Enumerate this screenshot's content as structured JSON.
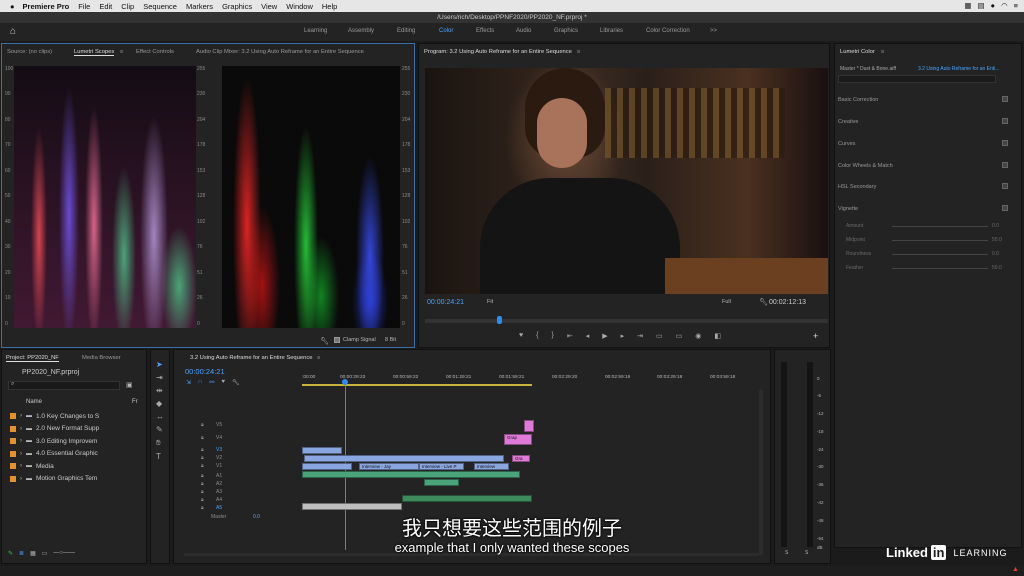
{
  "menubar": {
    "apple": "",
    "app": "Premiere Pro",
    "items": [
      "File",
      "Edit",
      "Clip",
      "Sequence",
      "Markers",
      "Graphics",
      "View",
      "Window",
      "Help"
    ]
  },
  "titlebar": "/Users/rich/Desktop/PPNF2020/PP2020_NF.prproj *",
  "workspaces": [
    "Learning",
    "Assembly",
    "Editing",
    "Color",
    "Effects",
    "Audio",
    "Graphics",
    "Libraries",
    "Color Correction"
  ],
  "workspace_more": ">>",
  "scopes": {
    "tabs": [
      "Source: (no clips)",
      "Lumetri Scopes",
      "Effect Controls",
      "Audio Clip Mixer: 3.2 Using Auto Reframe for an Entire Sequence"
    ],
    "left_axis": [
      "100",
      "90",
      "80",
      "70",
      "60",
      "50",
      "40",
      "30",
      "20",
      "10",
      "0"
    ],
    "right_axis": [
      "255",
      "230",
      "204",
      "178",
      "153",
      "128",
      "102",
      "76",
      "51",
      "26",
      "0"
    ],
    "clamp": "Clamp Signal",
    "bits": "8 Bit"
  },
  "program": {
    "title": "Program: 3.2 Using Auto Reframe for an Entire Sequence",
    "timecode": "00:00:24:21",
    "fit": "Fit",
    "full": "Full",
    "duration": "00:02:12:13"
  },
  "lumetri": {
    "title": "Lumetri Color",
    "master": "Master * Dust & Bone.aiff",
    "seq": "3.2 Using Auto Reframe for an Enti...",
    "sections": [
      "Basic Correction",
      "Creative",
      "Curves",
      "Color Wheels & Match",
      "HSL Secondary",
      "Vignette"
    ],
    "vignette": [
      {
        "label": "Amount",
        "val": "0.0"
      },
      {
        "label": "Midpoint",
        "val": "50.0"
      },
      {
        "label": "Roundness",
        "val": "0.0"
      },
      {
        "label": "Feather",
        "val": "50.0"
      }
    ]
  },
  "project": {
    "tabs": [
      "Project: PP2020_NF",
      "Media Browser"
    ],
    "file": "PP2020_NF.prproj",
    "col_name": "Name",
    "col_fr": "Fr",
    "bins": [
      "1.0 Key Changes to S",
      "2.0 New Format Supp",
      "3.0 Editing Improvem",
      "4.0 Essential Graphic",
      "Media",
      "Motion Graphics Tem"
    ]
  },
  "timeline": {
    "title": "3.2 Using Auto Reframe for an Entire Sequence",
    "timecode": "00:00:24:21",
    "ruler": [
      ":00:00",
      "00:00:29:23",
      "00:00:59:22",
      "00:01:29:21",
      "00:01:59:21",
      "00:02:29:20",
      "00:02:59:19",
      "00:03:29:18",
      "00:03:59:18"
    ],
    "video_tracks": [
      "V5",
      "V4",
      "V3",
      "V2",
      "V1"
    ],
    "audio_tracks": [
      "A1",
      "A2",
      "A3",
      "A4",
      "A5"
    ],
    "master": "Master",
    "master_val": "0.0",
    "clips": [
      "Grap",
      "Interview - Jay",
      "Interview - Live P",
      "Interview",
      "Gra"
    ]
  },
  "meter": {
    "scale": [
      "0",
      "-6",
      "-12",
      "-18",
      "-24",
      "-30",
      "-36",
      "-42",
      "-48",
      "-54",
      "dB"
    ],
    "solo": [
      "S",
      "S"
    ]
  },
  "subtitle": {
    "zh": "我只想要这些范围的例子",
    "en": "example that I only wanted these scopes"
  },
  "brand": {
    "name": "Linked",
    "in": "in",
    "learning": "LEARNING"
  }
}
